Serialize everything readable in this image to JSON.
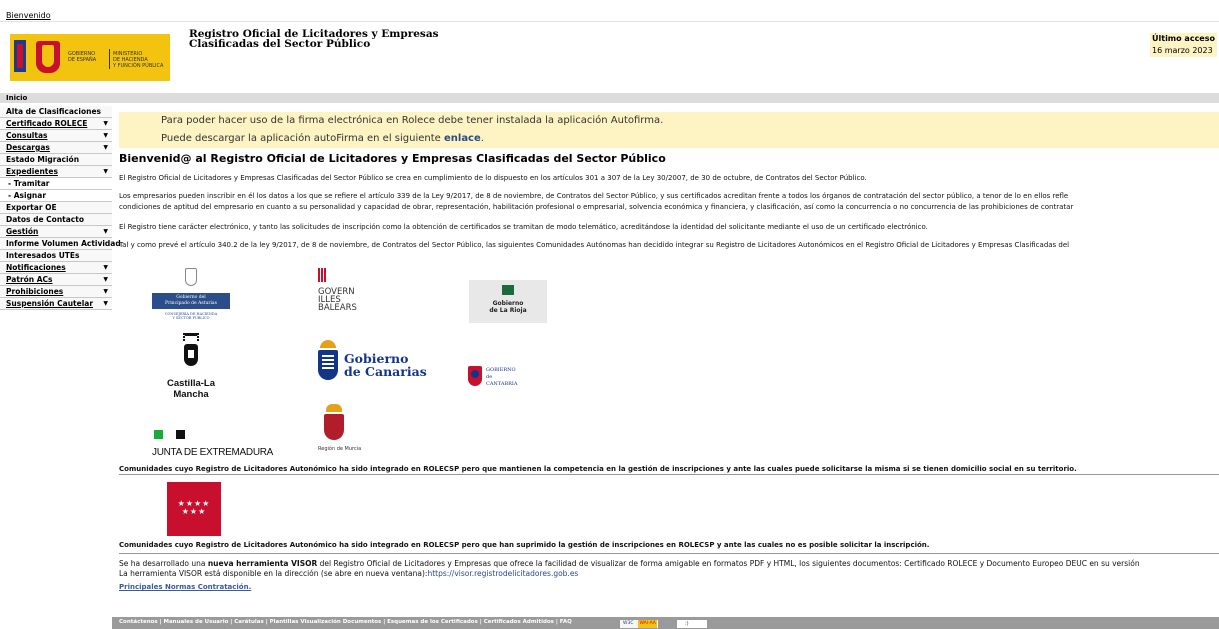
{
  "topbar": {
    "welcome_link": "Bienvenido"
  },
  "logo": {
    "gobierno": "GOBIERNO\nDE ESPAÑA",
    "ministerio": "MINISTERIO\nDE HACIENDA\nY FUNCIÓN PÚBLICA"
  },
  "site": {
    "title_line1": "Registro Oficial de Licitadores y Empresas",
    "title_line2": "Clasificadas del Sector Público"
  },
  "last_access": {
    "label": "Último acceso",
    "value": "16 marzo 2023"
  },
  "inicio": "Inicio",
  "sidebar": {
    "items": [
      {
        "label": "Alta de Clasificaciones",
        "dropdown": false,
        "sub": false
      },
      {
        "label": "Certificado ROLECE",
        "dropdown": true,
        "sub": false
      },
      {
        "label": "Consultas",
        "dropdown": true,
        "sub": false
      },
      {
        "label": "Descargas",
        "dropdown": true,
        "sub": false
      },
      {
        "label": "Estado Migración",
        "dropdown": false,
        "sub": false
      },
      {
        "label": "Expedientes",
        "dropdown": true,
        "sub": false
      },
      {
        "label": "- Tramitar",
        "dropdown": false,
        "sub": true
      },
      {
        "label": "- Asignar",
        "dropdown": false,
        "sub": true
      },
      {
        "label": "Exportar OE",
        "dropdown": false,
        "sub": false
      },
      {
        "label": "Datos de Contacto",
        "dropdown": false,
        "sub": false
      },
      {
        "label": "Gestión",
        "dropdown": true,
        "sub": false
      },
      {
        "label": "Informe Volumen Actividad",
        "dropdown": false,
        "sub": false
      },
      {
        "label": "Interesados UTEs",
        "dropdown": false,
        "sub": false
      },
      {
        "label": "Notificaciones",
        "dropdown": true,
        "sub": false
      },
      {
        "label": "Patrón ACs",
        "dropdown": true,
        "sub": false
      },
      {
        "label": "Prohibiciones",
        "dropdown": true,
        "sub": false
      },
      {
        "label": "Suspensión Cautelar",
        "dropdown": true,
        "sub": false
      }
    ]
  },
  "notice": {
    "line1": "Para poder hacer uso de la firma electrónica en Rolece debe tener instalada la aplicación Autofirma.",
    "line2_prefix": "Puede descargar la aplicación autoFirma en el siguiente ",
    "line2_link": "enlace",
    "line2_suffix": "."
  },
  "welcome_title": "Bienvenid@ al Registro Oficial de Licitadores y Empresas Clasificadas del Sector Público",
  "paragraphs": {
    "p1": "El Registro Oficial de Licitadores y Empresas Clasificadas del Sector Público se crea en cumplimiento de lo dispuesto en los artículos 301 a 307 de la Ley 30/2007, de 30 de octubre, de Contratos del Sector Público.",
    "p2a": "Los empresarios pueden inscribir en él los datos a los que se refiere el artículo 339 de la Ley 9/2017, de 8 de noviembre, de Contratos del Sector Público, y sus certificados acreditan frente a todos los órganos de contratación del sector público, a tenor de lo en ellos refle",
    "p2b": "condiciones de aptitud del empresario en cuanto a su personalidad y capacidad de obrar, representación, habilitación profesional o empresarial, solvencia económica y financiera, y clasificación, así como la concurrencia o no concurrencia de las prohibiciones de contratar",
    "p3": "El Registro tiene carácter electrónico, y tanto las solicitudes de inscripción como la obtención de certificados se tramitan de modo telemático, acreditándose la identidad del solicitante mediante el uso de un certificado electrónico.",
    "p4": "Tal y como prevé el artículo 340.2 de la ley 9/2017, de 8 de noviembre, de Contratos del Sector Público, las siguientes Comunidades Autónomas han decidido integrar su Registro de Licitadores Autonómicos en el Registro Oficial de Licitadores y Empresas Clasificadas del"
  },
  "regions": {
    "asturias_line1": "Gobierno del",
    "asturias_line2": "Principado de Asturias",
    "asturias_sub1": "CONSEJERÍA DE HACIENDA",
    "asturias_sub2": "Y SECTOR PÚBLICO",
    "baleares": "GOVERN\nILLES\nBALEARS",
    "rioja_line1": "Gobierno",
    "rioja_line2": "de La Rioja",
    "clm": "Castilla-La Mancha",
    "canarias_line1": "Gobierno",
    "canarias_line2": "de Canarias",
    "cantabria_line1": "GOBIERNO",
    "cantabria_line2": "de",
    "cantabria_line3": "CANTABRIA",
    "extremadura": "JUNTA DE EXTREMADURA",
    "murcia": "Región de Murcia"
  },
  "caption1": "Comunidades cuyo Registro de Licitadores Autonómico ha sido integrado en ROLECSP pero que mantienen la competencia en la gestión de inscripciones y ante las cuales puede solicitarse la misma si se tienen domicilio social en su territorio.",
  "caption2": "Comunidades cuyo Registro de Licitadores Autonómico ha sido integrado en ROLECSP pero que han suprimido la gestión de inscripciones en ROLECSP y ante las cuales no es posible solicitar la inscripción.",
  "madrid_stars": {
    "row1": "★★★★",
    "row2": "★★★"
  },
  "visor": {
    "line1_prefix": "Se ha desarrollado una ",
    "line1_bold": "nueva herramienta VISOR",
    "line1_suffix": " del Registro Oficial de Licitadores y Empresas que ofrece la facilidad de visualizar de forma amigable en formatos PDF y HTML, los siguientes documentos: Certificado ROLECE y Documento Europeo DEUC en su versión",
    "line2_prefix": "La herramienta VISOR está disponible en la dirección (se abre en nueva ventana):",
    "line2_link": "https://visor.registrodelicitadores.gob.es"
  },
  "normas_link": "Principales Normas Contratación.",
  "footer": {
    "links": "Contáctenos | Manuales de Usuario | Carátulas | Plantillas Visualización Documentos | Esquemas de los Certificados  |  Certificados Admitidos | FAQ",
    "wai_label": "W3C",
    "wai_badge": "WAI-AA",
    "css_badge": ":)"
  },
  "colors": {
    "notice_bg": "#fdf3c3",
    "link": "#2b4a8b",
    "logo_yellow": "#f2c30f",
    "madrid_red": "#c8102e"
  }
}
